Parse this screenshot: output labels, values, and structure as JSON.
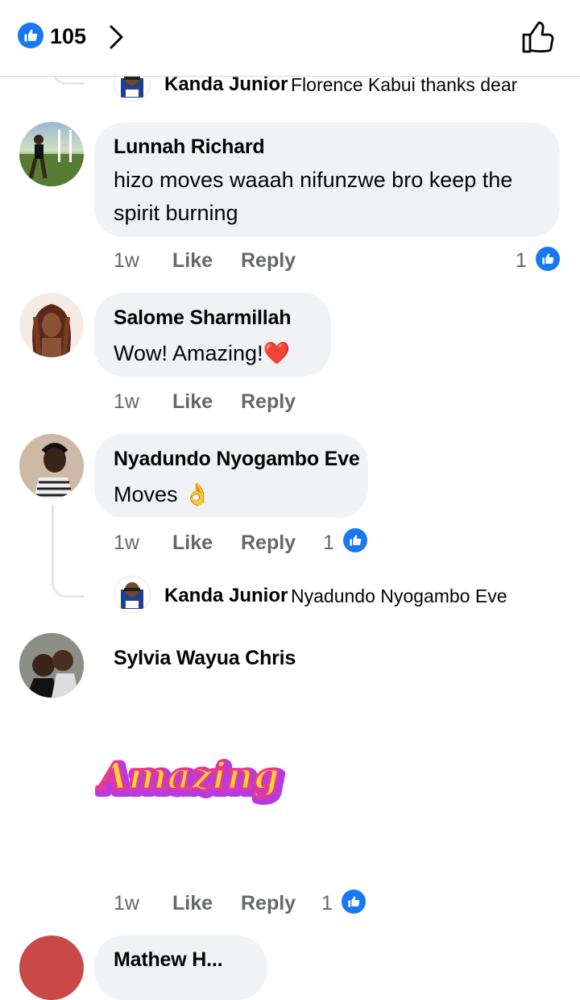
{
  "header": {
    "reaction_count": "105",
    "reaction_icon": "like-icon",
    "chevron_icon": "chevron-right-icon",
    "like_button_icon": "thumbs-up-outline-icon"
  },
  "top_reply": {
    "author": "Kanda Junior",
    "text": "Florence Kabui thanks dear"
  },
  "comments": [
    {
      "author": "Lunnah Richard",
      "lines": [
        "hizo moves waaah nifunzwe bro keep the",
        "spirit burning"
      ],
      "time": "1w",
      "like": "Like",
      "reply": "Reply",
      "reactions": "1"
    },
    {
      "author": "Salome Sharmillah",
      "text": "Wow! Amazing!",
      "emoji": "❤️",
      "time": "1w",
      "like": "Like",
      "reply": "Reply"
    },
    {
      "author": "Nyadundo Nyogambo Eve",
      "text": "Moves",
      "emoji": "👌",
      "time": "1w",
      "like": "Like",
      "reply": "Reply",
      "reactions": "1",
      "reply_preview": {
        "author": "Kanda Junior",
        "text": "Nyadundo Nyogambo Eve"
      }
    },
    {
      "author": "Sylvia Wayua Chris",
      "sticker_text": "Amazing",
      "time": "1w",
      "like": "Like",
      "reply": "Reply",
      "reactions": "1"
    },
    {
      "author": "Mathew H..."
    }
  ],
  "colors": {
    "brand_blue": "#1877f2",
    "bubble_bg": "#f0f2f5",
    "meta_gray": "#65676b"
  }
}
